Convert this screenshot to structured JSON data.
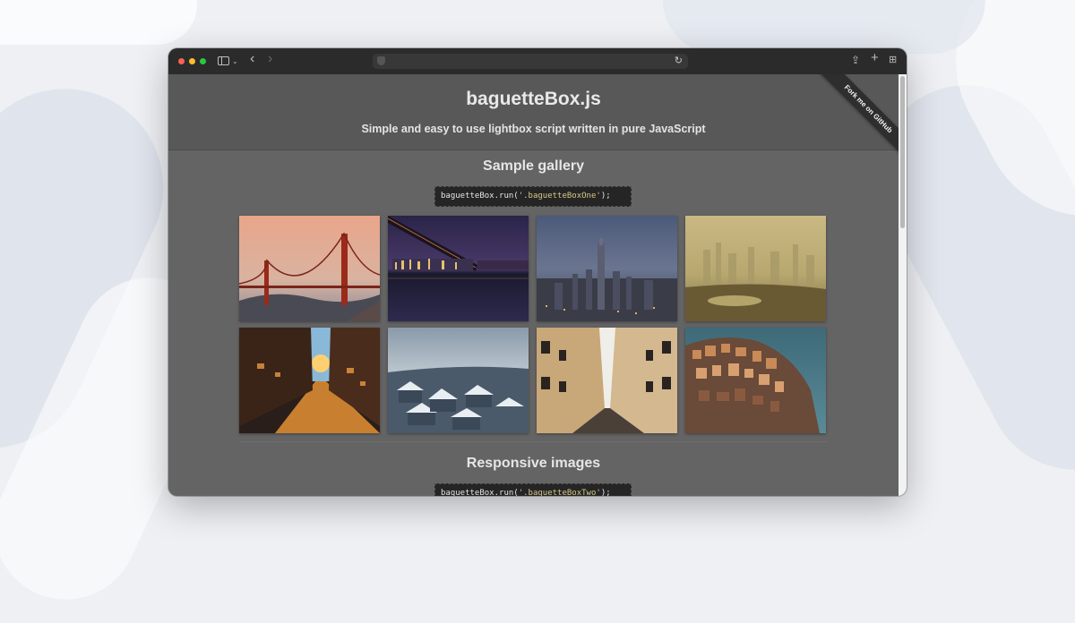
{
  "browser": {
    "icons": [
      "sidebar-icon",
      "chevron-down-icon",
      "back-icon",
      "forward-icon",
      "shield-icon",
      "reload-icon",
      "share-icon",
      "plus-icon",
      "tabs-icon"
    ],
    "glyphs": {
      "chevron": "⌄",
      "back": "‹",
      "forward": "›",
      "reload": "↻",
      "share": "⇪",
      "plus": "+",
      "tabs": "⊞"
    }
  },
  "page": {
    "title": "baguetteBox.js",
    "tagline": "Simple and easy to use lightbox script written in pure JavaScript",
    "ribbon": "Fork me on GitHub"
  },
  "sections": [
    {
      "title": "Sample gallery",
      "code_prefix": "baguetteBox.run(",
      "code_string": "'.baguetteBoxOne'",
      "code_suffix": ");"
    },
    {
      "title": "Responsive images",
      "code_prefix": "baguetteBox.run(",
      "code_string": "'.baguetteBoxTwo'",
      "code_suffix": ");"
    }
  ],
  "gallery": {
    "thumbnails": [
      "golden-gate-bridge-sunset",
      "night-bridge-skyline",
      "city-aerial-dusk",
      "hazy-skyline-water",
      "sunset-street",
      "snowy-rooftops",
      "narrow-street-buildings",
      "cliffside-village"
    ]
  },
  "colors": {
    "header_bg": "#585858",
    "content_bg": "#646464",
    "code_bg": "#252525",
    "code_string": "#d5c98a"
  },
  "scroll": {
    "position_fraction": 0.0
  }
}
